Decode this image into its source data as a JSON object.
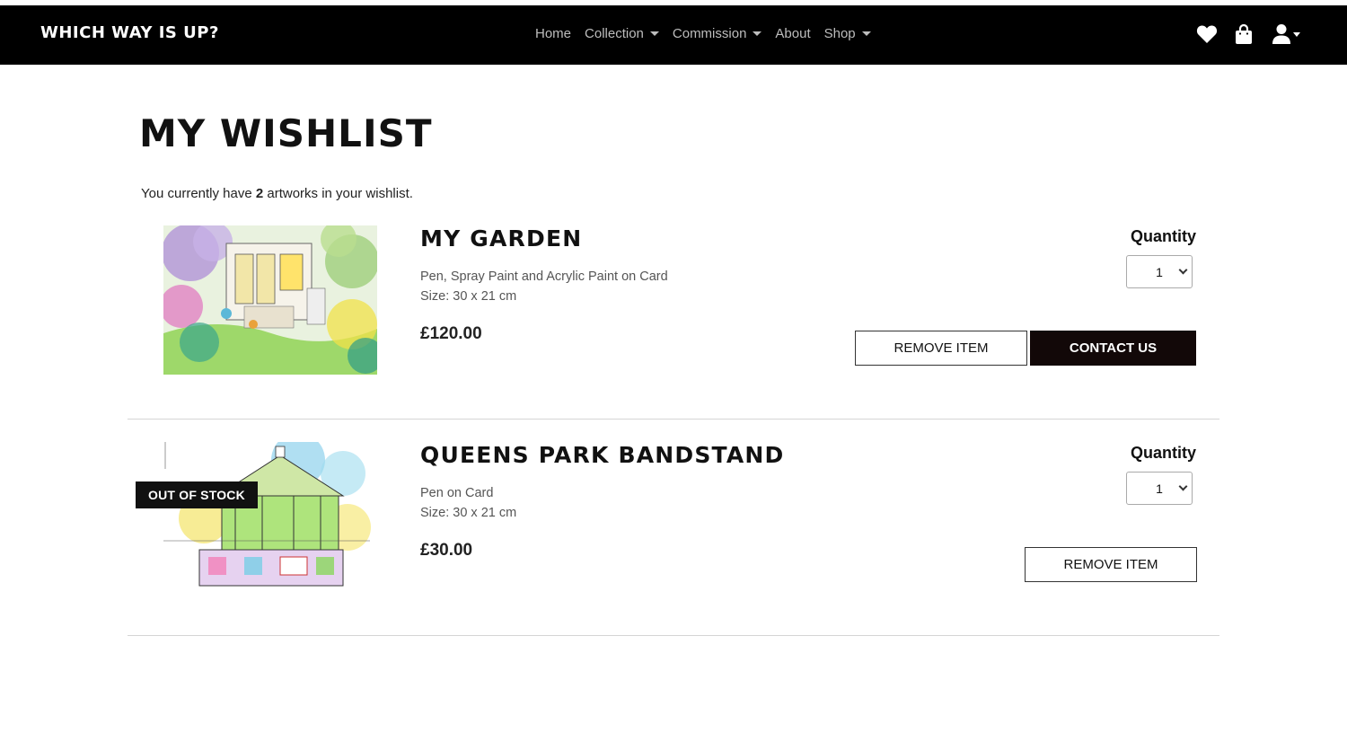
{
  "brand": "WHICH WAY IS UP?",
  "nav": {
    "items": [
      {
        "label": "Home",
        "dropdown": false
      },
      {
        "label": "Collection",
        "dropdown": true
      },
      {
        "label": "Commission",
        "dropdown": true
      },
      {
        "label": "About",
        "dropdown": false
      },
      {
        "label": "Shop",
        "dropdown": true
      }
    ],
    "icons": [
      "heart-icon",
      "shopping-bag-icon",
      "user-icon"
    ]
  },
  "page": {
    "title": "MY WISHLIST",
    "summary_prefix": "You currently have ",
    "summary_count": "2",
    "summary_suffix": " artworks in your wishlist."
  },
  "items": [
    {
      "title": "MY GARDEN",
      "medium": "Pen, Spray Paint and Acrylic Paint on Card",
      "size": "Size: 30 x 21 cm",
      "price": "£120.00",
      "quantity_label": "Quantity",
      "quantity": "1",
      "remove_label": "REMOVE ITEM",
      "contact_label": "CONTACT US",
      "out_of_stock": false
    },
    {
      "title": "QUEENS PARK BANDSTAND",
      "medium": "Pen on Card",
      "size": "Size: 30 x 21 cm",
      "price": "£30.00",
      "quantity_label": "Quantity",
      "quantity": "1",
      "remove_label": "REMOVE ITEM",
      "badge": "OUT OF STOCK",
      "out_of_stock": true
    }
  ],
  "colors": {
    "navbar_bg": "#000000",
    "nav_text": "#bdbdbd",
    "button_dark": "#120808",
    "divider": "#d5d5d5"
  }
}
